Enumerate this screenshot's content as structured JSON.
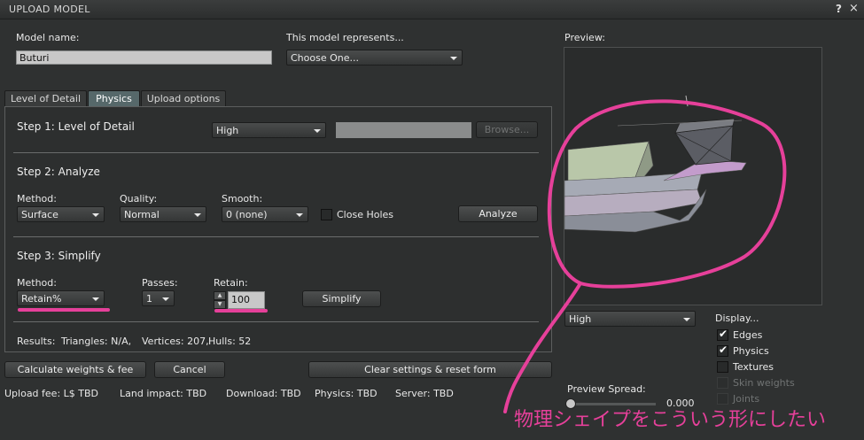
{
  "window": {
    "title": "UPLOAD MODEL",
    "help": "?",
    "close": "×"
  },
  "model_name": {
    "label": "Model name:",
    "value": "Buturi"
  },
  "represents": {
    "label": "This model represents...",
    "value": "Choose One..."
  },
  "tabs": [
    {
      "label": "Level of Detail"
    },
    {
      "label": "Physics"
    },
    {
      "label": "Upload options"
    }
  ],
  "step1": {
    "title": "Step 1: Level of Detail",
    "lod_value": "High",
    "browse": "Browse..."
  },
  "step2": {
    "title": "Step 2: Analyze",
    "method_label": "Method:",
    "method_value": "Surface",
    "quality_label": "Quality:",
    "quality_value": "Normal",
    "smooth_label": "Smooth:",
    "smooth_value": "0 (none)",
    "close_holes": "Close Holes",
    "analyze": "Analyze"
  },
  "step3": {
    "title": "Step 3: Simplify",
    "method_label": "Method:",
    "method_value": "Retain%",
    "passes_label": "Passes:",
    "passes_value": "1",
    "retain_label": "Retain:",
    "retain_value": "100",
    "simplify": "Simplify"
  },
  "results": {
    "label": "Results:",
    "triangles": "Triangles: N/A,",
    "vertices": "Vertices: 207,",
    "hulls": "Hulls: 52"
  },
  "buttons": {
    "calculate": "Calculate weights & fee",
    "cancel": "Cancel",
    "clear": "Clear settings & reset form"
  },
  "fees": {
    "upload": "Upload fee: L$ TBD",
    "land": "Land impact: TBD",
    "download": "Download: TBD",
    "physics": "Physics: TBD",
    "server": "Server: TBD"
  },
  "preview": {
    "label": "Preview:",
    "lod_value": "High",
    "display_label": "Display...",
    "options": [
      {
        "label": "Edges",
        "checked": true,
        "enabled": true
      },
      {
        "label": "Physics",
        "checked": true,
        "enabled": true
      },
      {
        "label": "Textures",
        "checked": false,
        "enabled": true
      },
      {
        "label": "Skin weights",
        "checked": false,
        "enabled": false
      },
      {
        "label": "Joints",
        "checked": false,
        "enabled": false
      }
    ],
    "spread_label": "Preview Spread:",
    "spread_value": "0.000",
    "spread_level": 0.0
  },
  "annotation": {
    "text": "物理シェイプをこういう形にしたい",
    "color": "#e6409a"
  }
}
